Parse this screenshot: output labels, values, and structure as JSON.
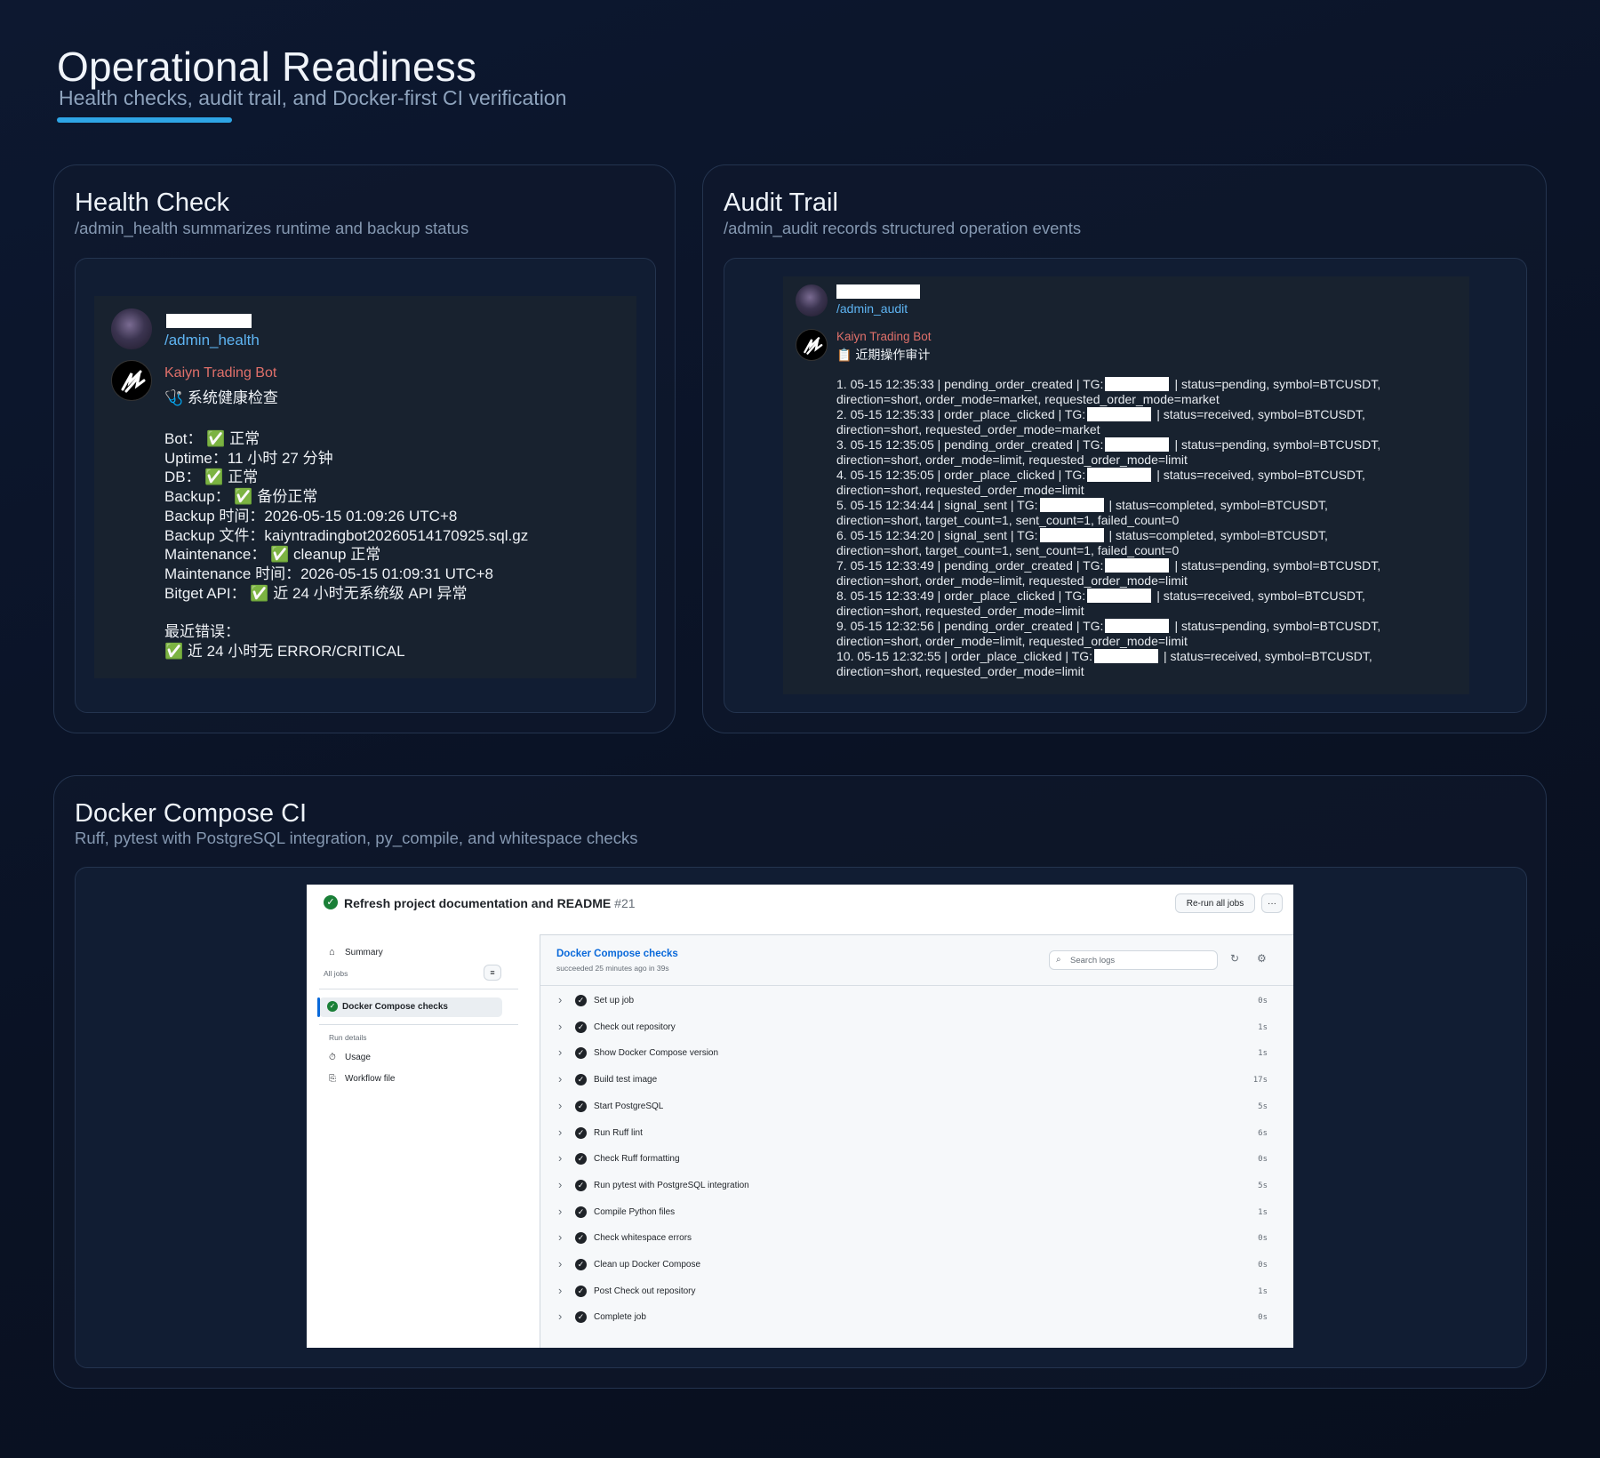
{
  "header": {
    "title": "Operational Readiness",
    "subtitle": "Health checks, audit trail, and Docker-first CI verification"
  },
  "health": {
    "title": "Health Check",
    "subtitle": "/admin_health summarizes runtime and backup status",
    "command": "/admin_health",
    "bot_name": "Kaiyn Trading Bot",
    "heading": "🩺 系统健康检查",
    "lines": [
      "Bot： ✅ 正常",
      "Uptime：11 小时 27 分钟",
      "DB： ✅ 正常",
      "Backup： ✅ 备份正常",
      "Backup 时间：2026-05-15 01:09:26 UTC+8",
      "Backup 文件：kaiyntradingbot20260514170925.sql.gz",
      "Maintenance： ✅ cleanup 正常",
      "Maintenance 时间：2026-05-15 01:09:31 UTC+8",
      "Bitget API： ✅ 近 24 小时无系统级 API 异常",
      "",
      "最近错误：",
      "✅ 近 24 小时无 ERROR/CRITICAL"
    ]
  },
  "audit": {
    "title": "Audit Trail",
    "subtitle": "/admin_audit records structured operation events",
    "command": "/admin_audit",
    "bot_name": "Kaiyn Trading Bot",
    "heading": "📋 近期操作审计",
    "entries": [
      {
        "head": "1. 05-15 12:35:33 | pending_order_created | TG:",
        "tail": "| status=pending, symbol=BTCUSDT,",
        "detail": "direction=short, order_mode=market, requested_order_mode=market"
      },
      {
        "head": "2. 05-15 12:35:33 | order_place_clicked | TG:",
        "tail": "| status=received, symbol=BTCUSDT,",
        "detail": "direction=short, requested_order_mode=market"
      },
      {
        "head": "3. 05-15 12:35:05 | pending_order_created | TG:",
        "tail": "| status=pending, symbol=BTCUSDT,",
        "detail": "direction=short, order_mode=limit, requested_order_mode=limit"
      },
      {
        "head": "4. 05-15 12:35:05 | order_place_clicked | TG:",
        "tail": "| status=received, symbol=BTCUSDT,",
        "detail": "direction=short, requested_order_mode=limit"
      },
      {
        "head": "5. 05-15 12:34:44 | signal_sent | TG:",
        "tail": "| status=completed, symbol=BTCUSDT,",
        "detail": "direction=short, target_count=1, sent_count=1, failed_count=0"
      },
      {
        "head": "6. 05-15 12:34:20 | signal_sent | TG:",
        "tail": "| status=completed, symbol=BTCUSDT,",
        "detail": "direction=short, target_count=1, sent_count=1, failed_count=0"
      },
      {
        "head": "7. 05-15 12:33:49 | pending_order_created | TG:",
        "tail": "| status=pending, symbol=BTCUSDT,",
        "detail": "direction=short, order_mode=limit, requested_order_mode=limit"
      },
      {
        "head": "8. 05-15 12:33:49 | order_place_clicked | TG:",
        "tail": "| status=received, symbol=BTCUSDT,",
        "detail": "direction=short, requested_order_mode=limit"
      },
      {
        "head": "9. 05-15 12:32:56 | pending_order_created | TG:",
        "tail": "| status=pending, symbol=BTCUSDT,",
        "detail": "direction=short, order_mode=limit, requested_order_mode=limit"
      },
      {
        "head": "10. 05-15 12:32:55 | order_place_clicked | TG:",
        "tail": "| status=received, symbol=BTCUSDT,",
        "detail": "direction=short, requested_order_mode=limit"
      }
    ]
  },
  "ci": {
    "title": "Docker Compose CI",
    "subtitle": "Ruff, pytest with PostgreSQL integration, py_compile, and whitespace checks",
    "run_title": "Refresh project documentation and README",
    "run_number": "#21",
    "rerun_label": "Re-run all jobs",
    "more_label": "···",
    "summary_label": "Summary",
    "all_jobs_label": "All jobs",
    "job_label": "Docker Compose checks",
    "run_details_label": "Run details",
    "usage_label": "Usage",
    "workflow_label": "Workflow file",
    "job_title": "Docker Compose checks",
    "job_status": "succeeded 25 minutes ago in 39s",
    "search_placeholder": "Search logs",
    "steps": [
      {
        "name": "Set up job",
        "duration": "0s"
      },
      {
        "name": "Check out repository",
        "duration": "1s"
      },
      {
        "name": "Show Docker Compose version",
        "duration": "1s"
      },
      {
        "name": "Build test image",
        "duration": "17s"
      },
      {
        "name": "Start PostgreSQL",
        "duration": "5s"
      },
      {
        "name": "Run Ruff lint",
        "duration": "6s"
      },
      {
        "name": "Check Ruff formatting",
        "duration": "0s"
      },
      {
        "name": "Run pytest with PostgreSQL integration",
        "duration": "5s"
      },
      {
        "name": "Compile Python files",
        "duration": "1s"
      },
      {
        "name": "Check whitespace errors",
        "duration": "0s"
      },
      {
        "name": "Clean up Docker Compose",
        "duration": "0s"
      },
      {
        "name": "Post Check out repository",
        "duration": "1s"
      },
      {
        "name": "Complete job",
        "duration": "0s"
      }
    ]
  },
  "colors": {
    "accent": "#2ea5e6",
    "command_link": "#5eb4f2",
    "bot_name": "#e0706a",
    "success": "#1a7f37"
  }
}
